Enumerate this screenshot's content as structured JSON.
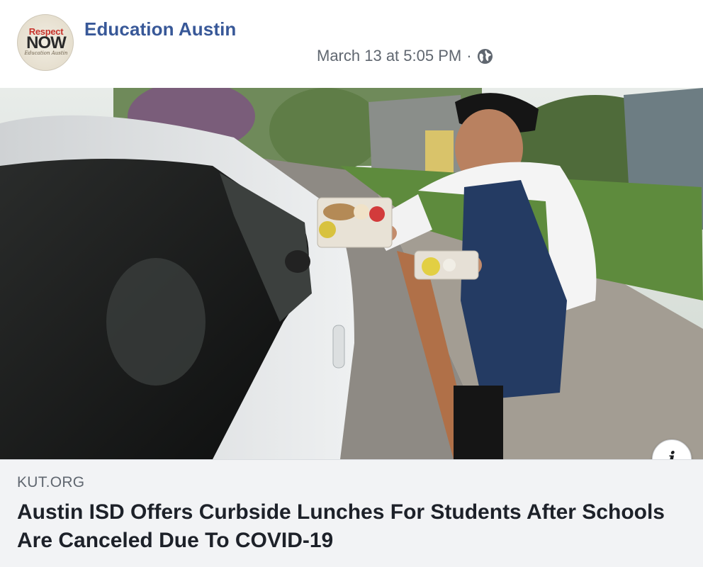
{
  "post": {
    "page_name": "Education Austin",
    "timestamp": "March 13 at 5:05 PM",
    "separator": "·",
    "privacy_icon": "globe-icon",
    "avatar": {
      "line1": "Respect",
      "line2": "NOW",
      "line3": "Education Austin"
    }
  },
  "link": {
    "domain": "KUT.ORG",
    "headline": "Austin ISD Offers Curbside Lunches For Students After Schools Are Canceled Due To COVID-19",
    "info_icon": "info-icon",
    "info_glyph": "i"
  },
  "colors": {
    "page_name": "#385898",
    "meta_text": "#606770",
    "link_bg": "#f2f3f5",
    "headline": "#1d2129"
  }
}
